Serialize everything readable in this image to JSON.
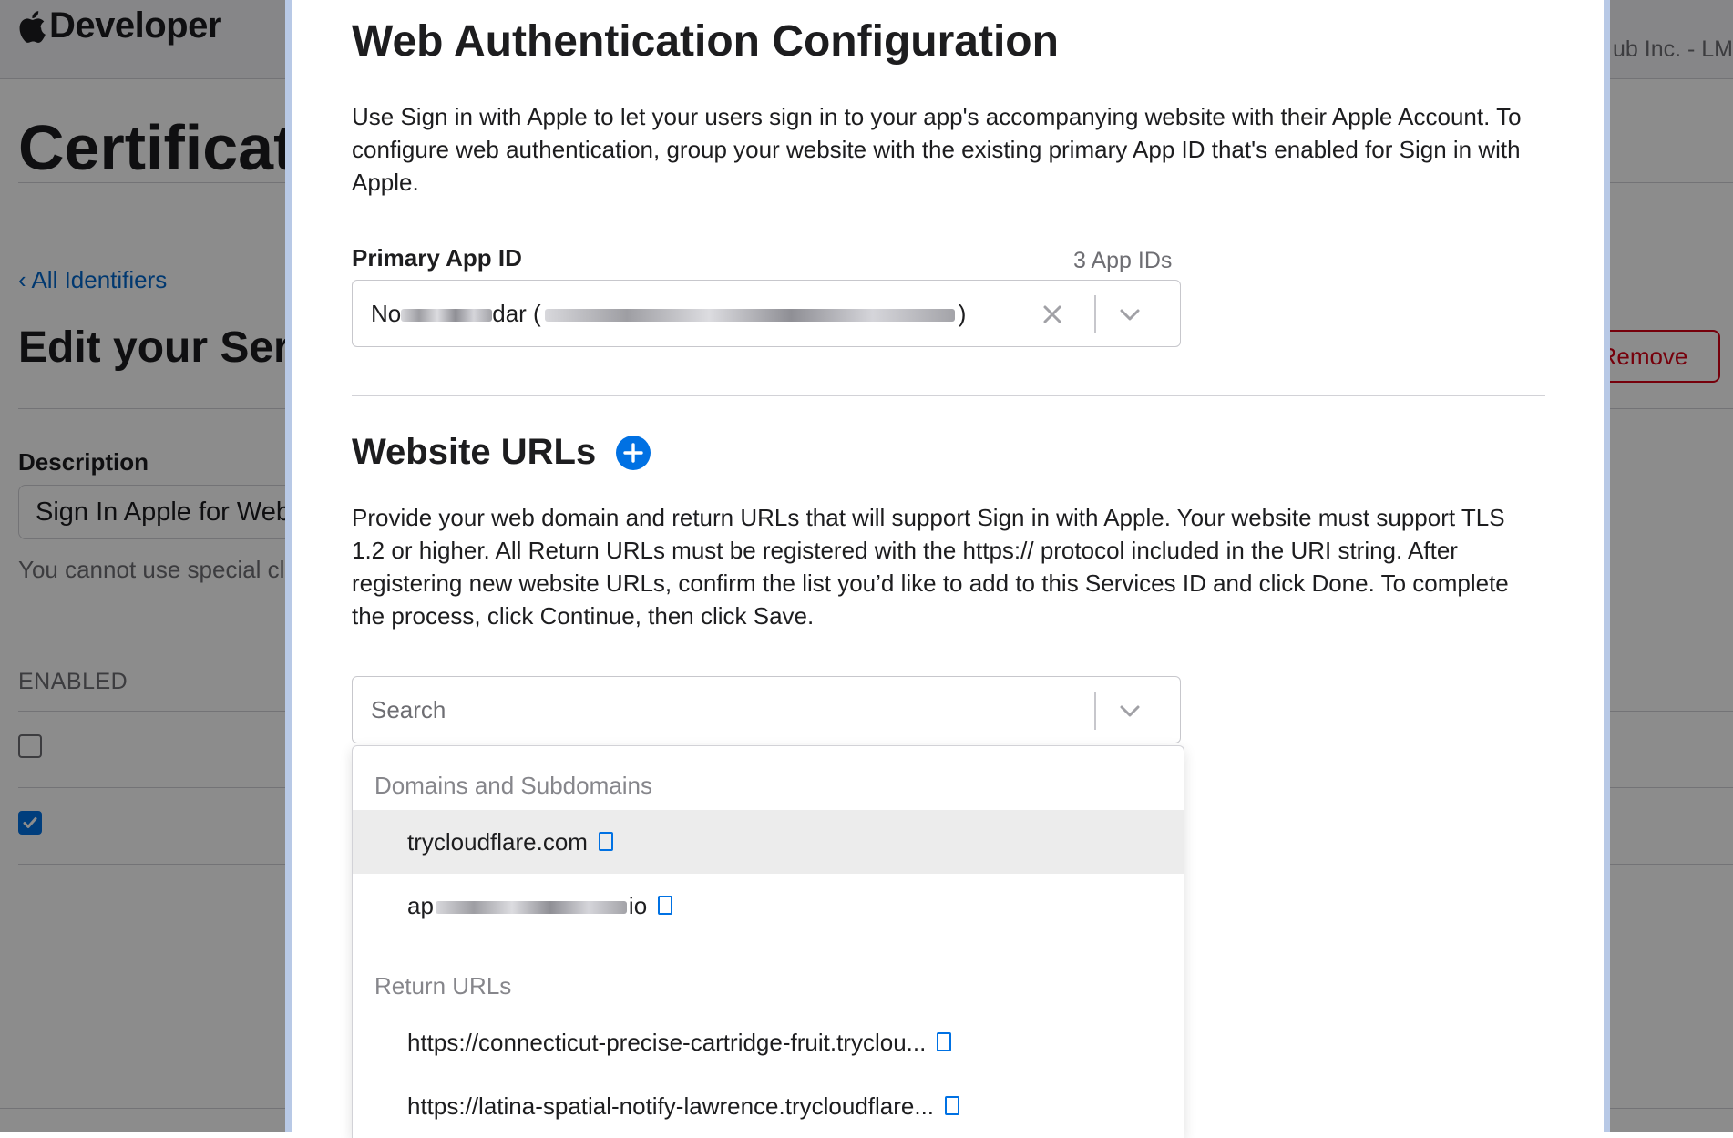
{
  "background": {
    "brand": "Developer",
    "team": "ub Inc. - LM",
    "page_title": "Certificat",
    "back_link": "‹ All Identifiers",
    "section_title": "Edit your Serv",
    "remove_label": "Remove",
    "description_label": "Description",
    "description_value": "Sign In Apple for Web",
    "description_hint": "You cannot use special cl",
    "enabled_label": "ENABLED",
    "checkboxes": [
      {
        "checked": false
      },
      {
        "checked": true
      }
    ]
  },
  "modal": {
    "title": "Web Authentication Configuration",
    "intro": "Use Sign in with Apple to let your users sign in to your app's accompanying website with their Apple Account. To configure web authentication, group your website with the existing primary App ID that's enabled for Sign in with Apple.",
    "primary_label": "Primary App ID",
    "primary_count": "3 App IDs",
    "primary_value_start": "No",
    "primary_value_mid": "dar (",
    "primary_value_end": ")",
    "website_urls_title": "Website URLs",
    "provide_text": "Provide your web domain and return URLs that will support Sign in with Apple. Your website must support TLS 1.2 or higher. All Return URLs must be registered with the https:// protocol included in the URI string. After registering new website URLs, confirm the list you’d like to add to this Services ID and click Done. To complete the process, click Continue, then click Save.",
    "search_placeholder": "Search",
    "dropdown": {
      "group_domains": "Domains and Subdomains",
      "domains": [
        {
          "label": "trycloudflare.com",
          "highlighted": true
        },
        {
          "label_start": "ap",
          "label_end": "io",
          "highlighted": false
        }
      ],
      "group_returns": "Return URLs",
      "returns": [
        {
          "label": "https://connecticut-precise-cartridge-fruit.tryclou..."
        },
        {
          "label": "https://latina-spatial-notify-lawrence.trycloudflare..."
        }
      ]
    }
  },
  "colors": {
    "accent": "#0071e3",
    "link": "#0066cc",
    "danger": "#d70015",
    "highlight_row": "#ececec"
  }
}
